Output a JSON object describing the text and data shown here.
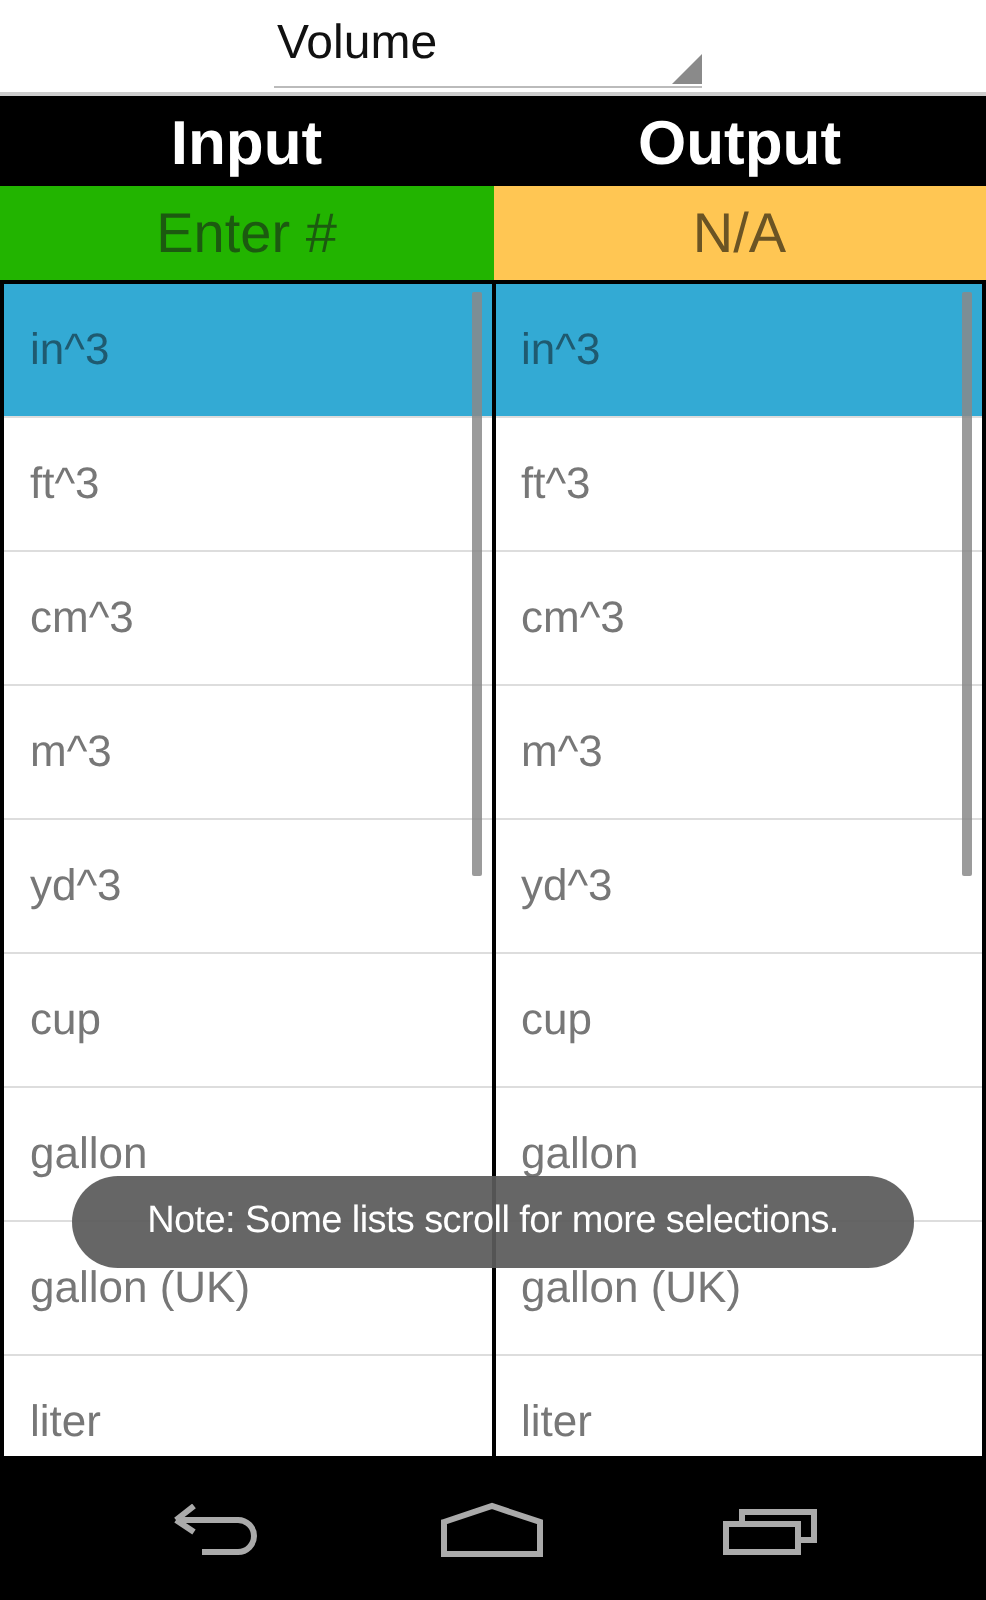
{
  "unit_type": {
    "value": "Volume"
  },
  "columns": [
    {
      "title": "Input",
      "field": {
        "kind": "input",
        "placeholder": "Enter #"
      },
      "units": [
        {
          "label": "in^3",
          "selected": true
        },
        {
          "label": "ft^3",
          "selected": false
        },
        {
          "label": "cm^3",
          "selected": false
        },
        {
          "label": "m^3",
          "selected": false
        },
        {
          "label": "yd^3",
          "selected": false
        },
        {
          "label": "cup",
          "selected": false
        },
        {
          "label": "gallon",
          "selected": false
        },
        {
          "label": "gallon (UK)",
          "selected": false
        },
        {
          "label": "liter",
          "selected": false
        }
      ]
    },
    {
      "title": "Output",
      "field": {
        "kind": "output",
        "value": "N/A"
      },
      "units": [
        {
          "label": "in^3",
          "selected": true
        },
        {
          "label": "ft^3",
          "selected": false
        },
        {
          "label": "cm^3",
          "selected": false
        },
        {
          "label": "m^3",
          "selected": false
        },
        {
          "label": "yd^3",
          "selected": false
        },
        {
          "label": "cup",
          "selected": false
        },
        {
          "label": "gallon",
          "selected": false
        },
        {
          "label": "gallon (UK)",
          "selected": false
        },
        {
          "label": "liter",
          "selected": false
        }
      ]
    }
  ],
  "toast": "Note: Some lists scroll for more selections."
}
